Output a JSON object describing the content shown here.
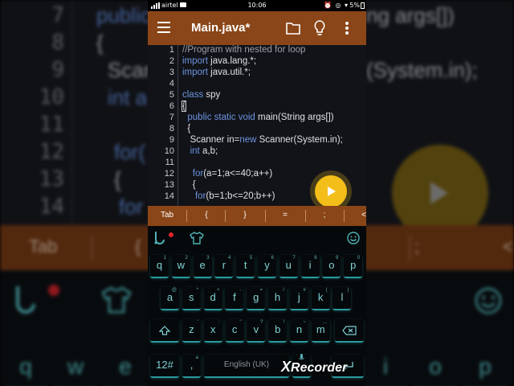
{
  "status_bar": {
    "carrier": "airtel",
    "time": "10:06",
    "battery": "5%"
  },
  "toolbar": {
    "title": "Main.java*",
    "icons": [
      "menu-icon",
      "folder-icon",
      "bulb-icon",
      "more-vert-icon"
    ]
  },
  "editor": {
    "lines": [
      {
        "n": "1",
        "text": "//Program with nested for loop"
      },
      {
        "n": "2",
        "text": "import java.lang.*;"
      },
      {
        "n": "3",
        "text": "import java.util.*;"
      },
      {
        "n": "4",
        "text": ""
      },
      {
        "n": "5",
        "text": "class spy"
      },
      {
        "n": "6",
        "text": "{"
      },
      {
        "n": "7",
        "text": "  public static void main(String args[])"
      },
      {
        "n": "8",
        "text": "  {"
      },
      {
        "n": "9",
        "text": "   Scanner in=new Scanner(System.in);"
      },
      {
        "n": "10",
        "text": "   int a,b;"
      },
      {
        "n": "11",
        "text": ""
      },
      {
        "n": "12",
        "text": "    for(a=1;a<=40;a++)"
      },
      {
        "n": "13",
        "text": "    {"
      },
      {
        "n": "14",
        "text": "     for(b=1;b<=20;b++)"
      }
    ]
  },
  "symbol_bar": [
    "Tab",
    "{",
    "}",
    "=",
    ";",
    "<"
  ],
  "keyboard": {
    "row1": [
      {
        "k": "q",
        "s": "1"
      },
      {
        "k": "w",
        "s": "2"
      },
      {
        "k": "e",
        "s": "3"
      },
      {
        "k": "r",
        "s": "4"
      },
      {
        "k": "t",
        "s": "5"
      },
      {
        "k": "y",
        "s": "6"
      },
      {
        "k": "u",
        "s": "7"
      },
      {
        "k": "i",
        "s": "8"
      },
      {
        "k": "o",
        "s": "9"
      },
      {
        "k": "p",
        "s": "0"
      }
    ],
    "row2": [
      {
        "k": "a",
        "s": "@"
      },
      {
        "k": "s",
        "s": "*"
      },
      {
        "k": "d",
        "s": "+"
      },
      {
        "k": "f",
        "s": "-"
      },
      {
        "k": "g",
        "s": "="
      },
      {
        "k": "h",
        "s": "/"
      },
      {
        "k": "j",
        "s": "#"
      },
      {
        "k": "k",
        "s": "("
      },
      {
        "k": "l",
        "s": ")"
      }
    ],
    "row3": [
      {
        "k": "z",
        "s": "'"
      },
      {
        "k": "x",
        "s": ":"
      },
      {
        "k": "c",
        "s": "\""
      },
      {
        "k": "v",
        "s": "?"
      },
      {
        "k": "b",
        "s": "!"
      },
      {
        "k": "n",
        "s": "~"
      },
      {
        "k": "m",
        "s": "…"
      }
    ],
    "numkey": "12#",
    "comma": ",",
    "comma_sup": "a",
    "space_label": "English (UK)",
    "period": "."
  },
  "background": {
    "line_numbers": [
      "7",
      "8",
      "9",
      "10",
      "11",
      "12",
      "13",
      "14"
    ],
    "code": [
      "public",
      "{",
      "Scan",
      "int a",
      "",
      "for(",
      "{",
      "for"
    ],
    "right_code": [
      "ng args[])",
      "",
      "(System.in);"
    ],
    "symbols": [
      "Tab",
      "{",
      "}",
      "=",
      ";",
      "<"
    ],
    "keys_top": [
      "q",
      "w",
      "e",
      "i",
      "o",
      "p"
    ]
  },
  "watermark": {
    "x": "X",
    "rest": "Recorder"
  },
  "colors": {
    "toolbar": "#8a4618",
    "key_accent": "#2a9aa0",
    "keyword": "#6d94e0",
    "play_button": "#f4be1a"
  }
}
